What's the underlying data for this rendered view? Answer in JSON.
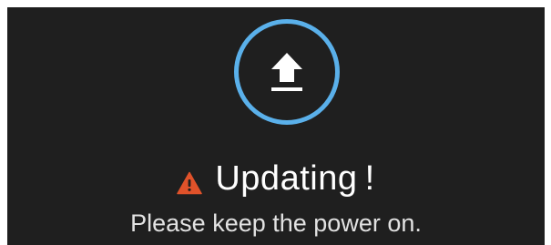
{
  "dialog": {
    "title": "Updating !",
    "message": "Please keep the power on.",
    "icons": {
      "main": "upload-icon",
      "status": "warning-icon"
    },
    "colors": {
      "background": "#1f1f1f",
      "accent": "#5ab0ea",
      "warning": "#e0522a",
      "text": "#ffffff"
    }
  }
}
